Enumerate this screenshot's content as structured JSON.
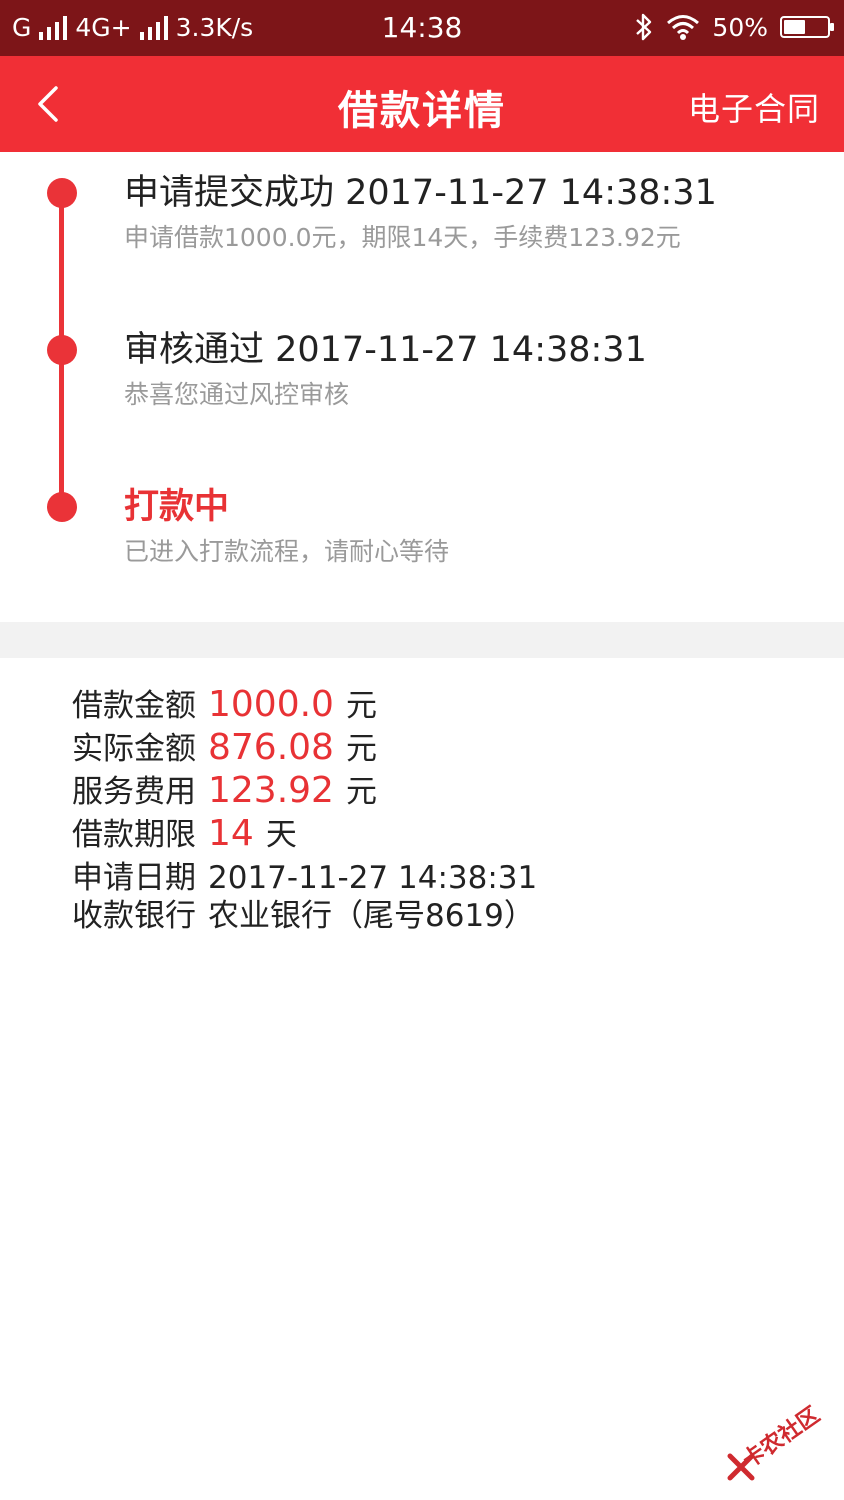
{
  "status_bar": {
    "carrier1": "G",
    "carrier2": "4G+",
    "speed": "3.3K/s",
    "time": "14:38",
    "battery_text": "50%",
    "battery_level": 0.5
  },
  "header": {
    "title": "借款详情",
    "contract_link": "电子合同",
    "color": "#f12f36"
  },
  "timeline": [
    {
      "title": "申请提交成功 2017-11-27 14:38:31",
      "desc": "申请借款1000.0元，期限14天，手续费123.92元"
    },
    {
      "title": "审核通过 2017-11-27 14:38:31",
      "desc": "恭喜您通过风控审核"
    },
    {
      "title": "打款中",
      "desc": "已进入打款流程，请耐心等待"
    }
  ],
  "details": {
    "amount": {
      "label": "借款金额",
      "value": "1000.0",
      "unit": "元"
    },
    "actual": {
      "label": "实际金额",
      "value": "876.08",
      "unit": "元"
    },
    "fee": {
      "label": "服务费用",
      "value": "123.92",
      "unit": "元"
    },
    "term": {
      "label": "借款期限",
      "value": "14",
      "unit": "天"
    },
    "date": {
      "label": "申请日期",
      "value": "2017-11-27 14:38:31"
    },
    "bank": {
      "label": "收款银行",
      "value": "农业银行（尾号8619）"
    }
  },
  "accent_color": "#e83235",
  "watermark": "卡农社区"
}
